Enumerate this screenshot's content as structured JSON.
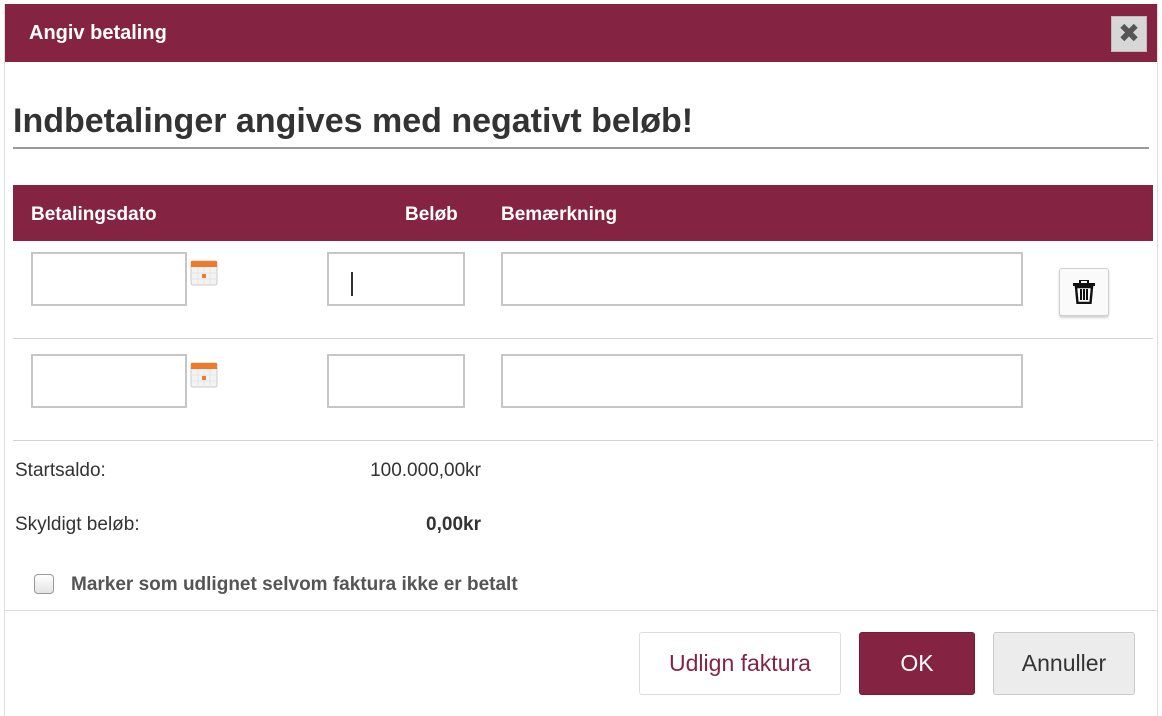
{
  "dialog": {
    "title": "Angiv betaling",
    "close_glyph": "✖",
    "heading": "Indbetalinger angives med negativt beløb!"
  },
  "table": {
    "headers": {
      "date": "Betalingsdato",
      "amount": "Beløb",
      "note": "Bemærkning"
    },
    "rows": [
      {
        "date": "",
        "amount": "",
        "note": "",
        "has_delete": true
      },
      {
        "date": "",
        "amount": "",
        "note": "",
        "has_delete": false
      }
    ]
  },
  "summary": {
    "start_balance_label": "Startsaldo:",
    "start_balance_value": "100.000,00kr",
    "owed_label": "Skyldigt beløb:",
    "owed_value": "0,00kr"
  },
  "checkbox": {
    "label": "Marker som udlignet selvom faktura ikke er betalt",
    "checked": false
  },
  "buttons": {
    "settle": "Udlign faktura",
    "ok": "OK",
    "cancel": "Annuller"
  },
  "icons": {
    "calendar": "calendar-icon",
    "trash": "trash-icon",
    "close": "close-icon"
  },
  "colors": {
    "brand": "#852442",
    "border": "#c6c6c6",
    "calendar_accent": "#f07a2a"
  }
}
